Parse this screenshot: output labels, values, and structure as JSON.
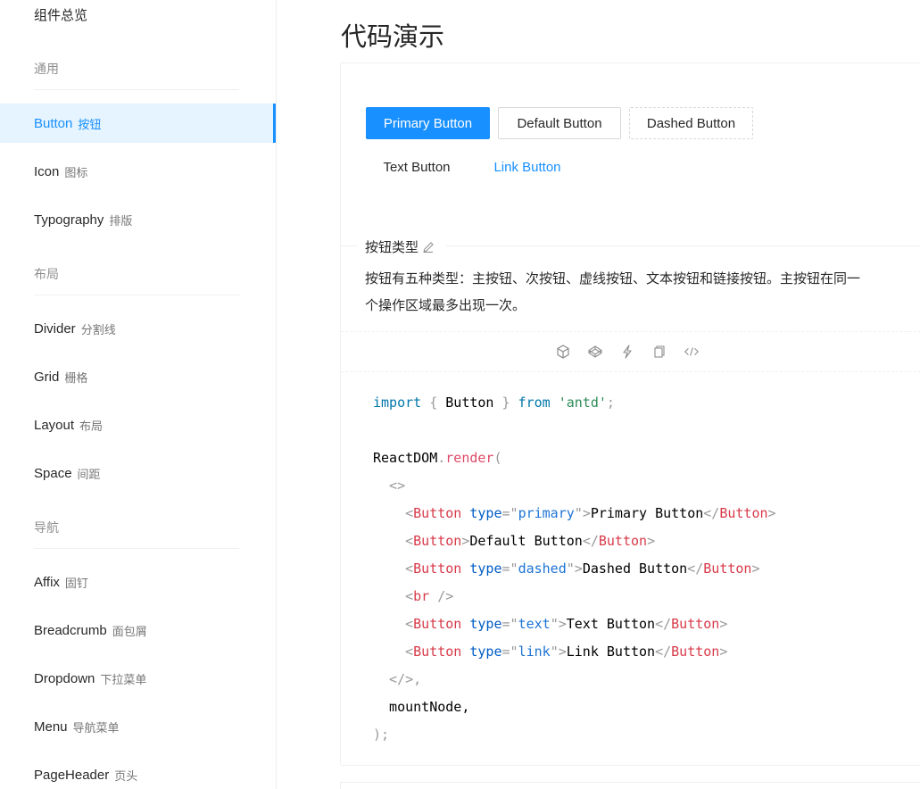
{
  "sidebar": {
    "overview": "组件总览",
    "groups": [
      {
        "title": "通用"
      },
      {
        "title": "布局"
      },
      {
        "title": "导航"
      }
    ],
    "items": [
      {
        "label": "Button",
        "sub": "按钮"
      },
      {
        "label": "Icon",
        "sub": "图标"
      },
      {
        "label": "Typography",
        "sub": "排版"
      },
      {
        "label": "Divider",
        "sub": "分割线"
      },
      {
        "label": "Grid",
        "sub": "栅格"
      },
      {
        "label": "Layout",
        "sub": "布局"
      },
      {
        "label": "Space",
        "sub": "间距"
      },
      {
        "label": "Affix",
        "sub": "固钉"
      },
      {
        "label": "Breadcrumb",
        "sub": "面包屑"
      },
      {
        "label": "Dropdown",
        "sub": "下拉菜单"
      },
      {
        "label": "Menu",
        "sub": "导航菜单"
      },
      {
        "label": "PageHeader",
        "sub": "页头"
      }
    ],
    "active_color": "#1890ff"
  },
  "main": {
    "title": "代码演示",
    "buttons": {
      "primary": "Primary Button",
      "default": "Default Button",
      "dashed": "Dashed Button",
      "text": "Text Button",
      "link": "Link Button"
    },
    "meta": {
      "title": "按钮类型",
      "desc_line1": "按钮有五种类型：主按钮、次按钮、虚线按钮、文本按钮和链接按钮。主按钮在同一",
      "desc_line2": "个操作区域最多出现一次。"
    },
    "action_icons": [
      "codesandbox-icon",
      "codepen-icon",
      "thunderbolt-icon",
      "copy-icon",
      "code-expand-icon"
    ]
  },
  "code": {
    "l1_import": "import",
    "l1_b1": " { ",
    "l1_button": "Button",
    "l1_b2": " } ",
    "l1_from": "from",
    "l1_str": " 'antd'",
    "l1_semi": ";",
    "l3_obj": "ReactDOM",
    "l3_dot": ".",
    "l3_fn": "render",
    "l3_paren": "(",
    "frag_open": "  <>",
    "indent": "    ",
    "lt": "<",
    "gt": ">",
    "close_lt": "</",
    "button_tag": "Button",
    "type_attr": "type",
    "eq": "=",
    "q": "\"",
    "primary": "primary",
    "dashed": "dashed",
    "text": "text",
    "link": "link",
    "primary_label": "Primary Button",
    "default_label": "Default Button",
    "dashed_label": "Dashed Button",
    "text_label": "Text Button",
    "link_label": "Link Button",
    "br_tag": "br",
    "self_close": " />",
    "frag_close": "  </>",
    "comma": ",",
    "mount": "  mountNode,",
    "end": ");"
  }
}
